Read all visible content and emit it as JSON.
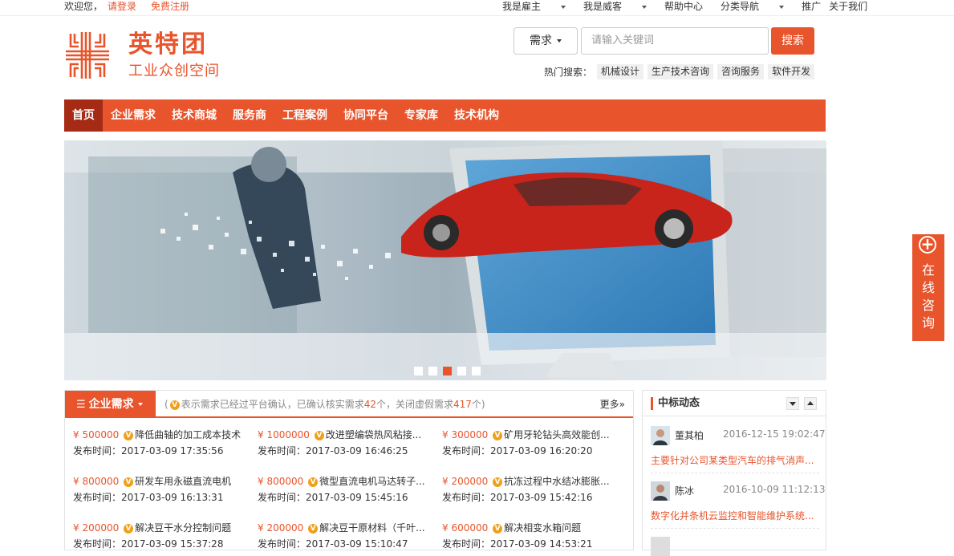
{
  "topbar": {
    "welcome": "欢迎您，",
    "login": "请登录",
    "register": "免费注册",
    "links": [
      "我是雇主",
      "我是威客",
      "帮助中心",
      "分类导航",
      "推广",
      "关于我们"
    ]
  },
  "logo": {
    "name": "英特团",
    "subtitle": "工业众创空间"
  },
  "search": {
    "category": "需求",
    "placeholder": "请输入关键词",
    "button": "搜索",
    "hot_label": "热门搜索：",
    "hot_tags": [
      "机械设计",
      "生产技术咨询",
      "咨询服务",
      "软件开发"
    ]
  },
  "nav": [
    "首页",
    "企业需求",
    "技术商城",
    "服务商",
    "工程案例",
    "协同平台",
    "专家库",
    "技术机构"
  ],
  "banner": {
    "slide_count": 5,
    "active_slide": 3
  },
  "consult": {
    "label": [
      "在",
      "线",
      "咨",
      "询"
    ]
  },
  "demand": {
    "tab": "企业需求",
    "info_pre": "表示需求已经过平台确认，已确认核实需求",
    "confirmed_count": "42",
    "info_mid": "个，关闭虚假需求",
    "closed_count": "417",
    "info_post": "个)",
    "more": "更多»",
    "items": [
      {
        "price": "¥ 500000",
        "title": "降低曲轴的加工成本技术",
        "time": "发布时间：2017-03-09 17:35:56"
      },
      {
        "price": "¥ 1000000",
        "title": "改进塑编袋热风粘接...",
        "time": "发布时间：2017-03-09 16:46:25"
      },
      {
        "price": "¥ 300000",
        "title": "矿用牙轮钻头高效能创...",
        "time": "发布时间：2017-03-09 16:20:20"
      },
      {
        "price": "¥ 800000",
        "title": "研发车用永磁直流电机",
        "time": "发布时间：2017-03-09 16:13:31"
      },
      {
        "price": "¥ 800000",
        "title": "微型直流电机马达转子...",
        "time": "发布时间：2017-03-09 15:45:16"
      },
      {
        "price": "¥ 200000",
        "title": "抗冻过程中水结冰膨胀...",
        "time": "发布时间：2017-03-09 15:42:16"
      },
      {
        "price": "¥ 200000",
        "title": "解决豆干水分控制问题",
        "time": "发布时间：2017-03-09 15:37:28"
      },
      {
        "price": "¥ 200000",
        "title": "解决豆干原材料（千叶...",
        "time": "发布时间：2017-03-09 15:10:47"
      },
      {
        "price": "¥ 600000",
        "title": "解决相变水箱问题",
        "time": "发布时间：2017-03-09 14:53:21"
      }
    ]
  },
  "bids": {
    "title": "中标动态",
    "items": [
      {
        "name": "董其柏",
        "time": "2016-12-15 19:02:47",
        "desc": "主要针对公司某类型汽车的排气消声..."
      },
      {
        "name": "陈冰",
        "time": "2016-10-09 11:12:13",
        "desc": "数字化并条机云监控和智能维护系统..."
      }
    ]
  },
  "colors": {
    "accent": "#e8542b",
    "nav_active": "#a62b14"
  }
}
